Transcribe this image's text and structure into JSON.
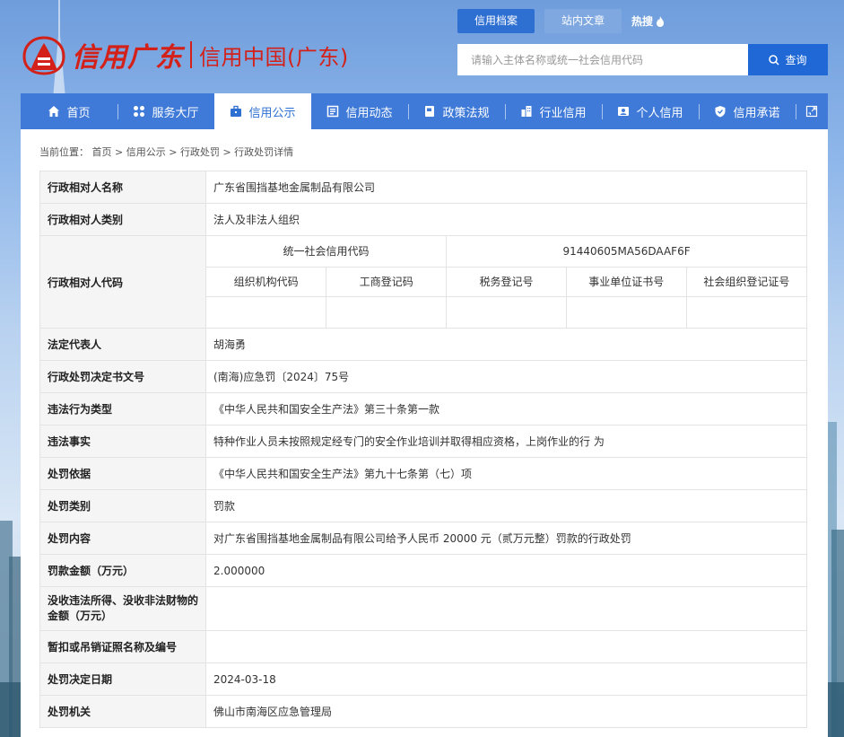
{
  "header": {
    "brand_cn": "信用广东",
    "site_title": "信用中国(广东)",
    "top_tabs": [
      "信用档案",
      "站内文章"
    ],
    "hot_search": "热搜",
    "search_placeholder": "请输入主体名称或统一社会信用代码",
    "search_button": "查询"
  },
  "nav": {
    "items": [
      {
        "label": "首页",
        "icon": "home-icon"
      },
      {
        "label": "服务大厅",
        "icon": "grid-icon"
      },
      {
        "label": "信用公示",
        "icon": "briefcase-icon"
      },
      {
        "label": "信用动态",
        "icon": "news-icon"
      },
      {
        "label": "政策法规",
        "icon": "book-icon"
      },
      {
        "label": "行业信用",
        "icon": "building-icon"
      },
      {
        "label": "个人信用",
        "icon": "id-card-icon"
      },
      {
        "label": "信用承诺",
        "icon": "shield-check-icon"
      }
    ],
    "active": "信用公示"
  },
  "breadcrumb": {
    "prefix": "当前位置：",
    "items": [
      "首页",
      "信用公示",
      "行政处罚",
      "行政处罚详情"
    ],
    "separator": ">"
  },
  "record": {
    "party_name_label": "行政相对人名称",
    "party_name": "广东省围挡基地金属制品有限公司",
    "party_type_label": "行政相对人类别",
    "party_type": "法人及非法人组织",
    "party_code_label": "行政相对人代码",
    "uscc_label": "统一社会信用代码",
    "uscc": "91440605MA56DAAF6F",
    "code_headers": [
      "组织机构代码",
      "工商登记码",
      "税务登记号",
      "事业单位证书号",
      "社会组织登记证号"
    ],
    "code_values": [
      "",
      "",
      "",
      "",
      ""
    ],
    "legal_rep_label": "法定代表人",
    "legal_rep": "胡海勇",
    "doc_no_label": "行政处罚决定书文号",
    "doc_no": "(南海)应急罚〔2024〕75号",
    "violation_type_label": "违法行为类型",
    "violation_type": "《中华人民共和国安全生产法》第三十条第一款",
    "facts_label": "违法事实",
    "facts": "特种作业人员未按照规定经专门的安全作业培训并取得相应资格，上岗作业的行 为",
    "basis_label": "处罚依据",
    "basis": "《中华人民共和国安全生产法》第九十七条第（七）项",
    "category_label": "处罚类别",
    "category": "罚款",
    "content_label": "处罚内容",
    "content": "对广东省围挡基地金属制品有限公司给予人民币 20000 元（贰万元整）罚款的行政处罚",
    "fine_label": "罚款金额（万元）",
    "fine": "2.000000",
    "confiscation_label": "没收违法所得、没收非法财物的金额（万元）",
    "confiscation": "",
    "license_label": "暂扣或吊销证照名称及编号",
    "license": "",
    "date_label": "处罚决定日期",
    "date": "2024-03-18",
    "authority_label": "处罚机关",
    "authority": "佛山市南海区应急管理局"
  },
  "colors": {
    "brand_red": "#d3211a",
    "nav_blue": "#3f7ad9",
    "accent_blue": "#1f68d6",
    "label_bg": "#f5f5f5"
  }
}
